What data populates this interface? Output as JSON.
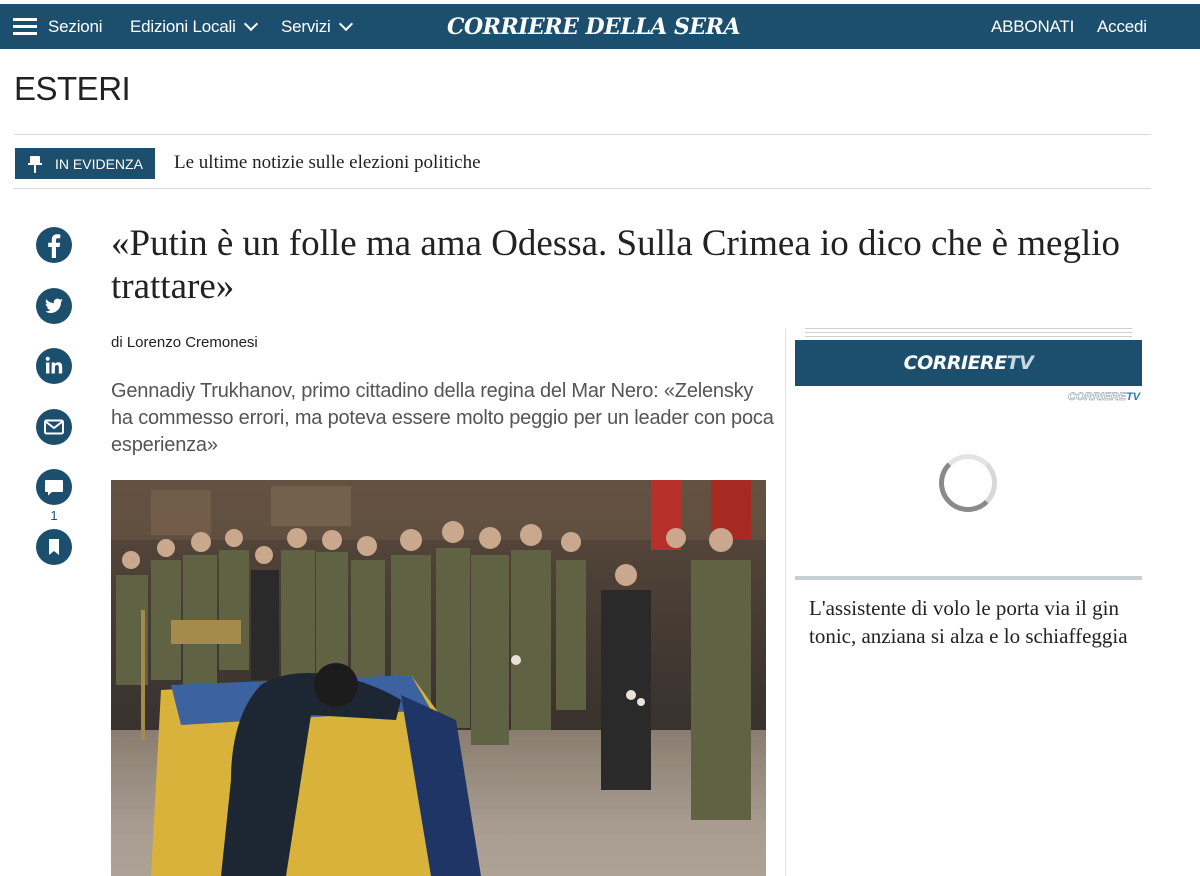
{
  "nav": {
    "sections_label": "Sezioni",
    "edizioni_label": "Edizioni Locali",
    "servizi_label": "Servizi",
    "logo": "CORRIERE DELLA SERA",
    "subscribe_label": "ABBONATI",
    "login_label": "Accedi"
  },
  "page": {
    "section": "ESTERI"
  },
  "evidenza": {
    "badge": "IN EVIDENZA",
    "text": "Le ultime notizie sulle elezioni politiche"
  },
  "article": {
    "headline": "«Putin è un folle ma ama Odessa. Sulla Crimea io dico che è meglio trattare»",
    "author": "di Lorenzo Cremonesi",
    "summary": "Gennadiy Trukhanov, primo cittadino della regina del Mar Nero: «Zelensky ha commesso errori, ma poteva essere molto peggio per un leader con poca esperienza»"
  },
  "share": {
    "icons": [
      "facebook-icon",
      "twitter-icon",
      "linkedin-icon",
      "email-icon",
      "comment-icon",
      "bookmark-icon"
    ],
    "comment_count": "1"
  },
  "sidebar": {
    "tv_brand": "CORRIERE",
    "tv_suffix": "TV",
    "related_title": "L'assistente di volo le porta via il gin tonic, anziana si alza e lo schiaffeggia"
  },
  "colors": {
    "brand": "#1c4f6e",
    "text": "#222222",
    "muted": "#555555"
  }
}
